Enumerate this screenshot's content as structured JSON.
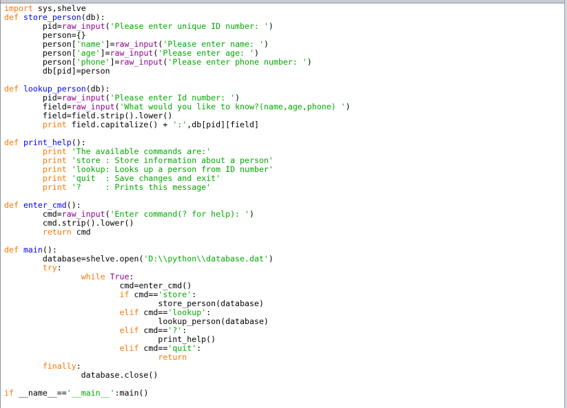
{
  "colors": {
    "keyword": "#ff7700",
    "builtin": "#900090",
    "string": "#00aa00",
    "definition": "#0000ff",
    "plain": "#000000",
    "background": "#ffffff"
  },
  "editor": {
    "lines": [
      [
        [
          "kw",
          "import"
        ],
        [
          "pl",
          " sys,shelve"
        ]
      ],
      [
        [
          "kw",
          "def"
        ],
        [
          "pl",
          " "
        ],
        [
          "df",
          "store_person"
        ],
        [
          "pl",
          "(db):"
        ]
      ],
      [
        [
          "pl",
          "        pid="
        ],
        [
          "bi",
          "raw_input"
        ],
        [
          "pl",
          "("
        ],
        [
          "str",
          "'Please enter unique ID number: '"
        ],
        [
          "pl",
          ")"
        ]
      ],
      [
        [
          "pl",
          "        person={}"
        ]
      ],
      [
        [
          "pl",
          "        person["
        ],
        [
          "str",
          "'name'"
        ],
        [
          "pl",
          "]="
        ],
        [
          "bi",
          "raw_input"
        ],
        [
          "pl",
          "("
        ],
        [
          "str",
          "'Please enter name: '"
        ],
        [
          "pl",
          ")"
        ]
      ],
      [
        [
          "pl",
          "        person["
        ],
        [
          "str",
          "'age'"
        ],
        [
          "pl",
          "]="
        ],
        [
          "bi",
          "raw_input"
        ],
        [
          "pl",
          "("
        ],
        [
          "str",
          "'Please enter age: '"
        ],
        [
          "pl",
          ")"
        ]
      ],
      [
        [
          "pl",
          "        person["
        ],
        [
          "str",
          "'phone'"
        ],
        [
          "pl",
          "]="
        ],
        [
          "bi",
          "raw_input"
        ],
        [
          "pl",
          "("
        ],
        [
          "str",
          "'Please enter phone number: '"
        ],
        [
          "pl",
          ")"
        ]
      ],
      [
        [
          "pl",
          "        db[pid]=person"
        ]
      ],
      [],
      [
        [
          "kw",
          "def"
        ],
        [
          "pl",
          " "
        ],
        [
          "df",
          "lookup_person"
        ],
        [
          "pl",
          "(db):"
        ]
      ],
      [
        [
          "pl",
          "        pid="
        ],
        [
          "bi",
          "raw_input"
        ],
        [
          "pl",
          "("
        ],
        [
          "str",
          "'Please enter Id number: '"
        ],
        [
          "pl",
          ")"
        ]
      ],
      [
        [
          "pl",
          "        field="
        ],
        [
          "bi",
          "raw_input"
        ],
        [
          "pl",
          "("
        ],
        [
          "str",
          "'What would you like to know?(name,age,phone) '"
        ],
        [
          "pl",
          ")"
        ]
      ],
      [
        [
          "pl",
          "        field=field.strip().lower()"
        ]
      ],
      [
        [
          "pl",
          "        "
        ],
        [
          "kw",
          "print"
        ],
        [
          "pl",
          " field.capitalize() + "
        ],
        [
          "str",
          "':'"
        ],
        [
          "pl",
          ",db[pid][field]"
        ]
      ],
      [],
      [
        [
          "kw",
          "def"
        ],
        [
          "pl",
          " "
        ],
        [
          "df",
          "print_help"
        ],
        [
          "pl",
          "():"
        ]
      ],
      [
        [
          "pl",
          "        "
        ],
        [
          "kw",
          "print"
        ],
        [
          "pl",
          " "
        ],
        [
          "str",
          "'The available commands are:'"
        ]
      ],
      [
        [
          "pl",
          "        "
        ],
        [
          "kw",
          "print"
        ],
        [
          "pl",
          " "
        ],
        [
          "str",
          "'store : Store information about a person'"
        ]
      ],
      [
        [
          "pl",
          "        "
        ],
        [
          "kw",
          "print"
        ],
        [
          "pl",
          " "
        ],
        [
          "str",
          "'lookup: Looks up a person from ID number'"
        ]
      ],
      [
        [
          "pl",
          "        "
        ],
        [
          "kw",
          "print"
        ],
        [
          "pl",
          " "
        ],
        [
          "str",
          "'quit  : Save changes and exit'"
        ]
      ],
      [
        [
          "pl",
          "        "
        ],
        [
          "kw",
          "print"
        ],
        [
          "pl",
          " "
        ],
        [
          "str",
          "'?     : Prints this message'"
        ]
      ],
      [],
      [
        [
          "kw",
          "def"
        ],
        [
          "pl",
          " "
        ],
        [
          "df",
          "enter_cmd"
        ],
        [
          "pl",
          "():"
        ]
      ],
      [
        [
          "pl",
          "        cmd="
        ],
        [
          "bi",
          "raw_input"
        ],
        [
          "pl",
          "("
        ],
        [
          "str",
          "'Enter command(? for help): '"
        ],
        [
          "pl",
          ")"
        ]
      ],
      [
        [
          "pl",
          "        cmd.strip().lower()"
        ]
      ],
      [
        [
          "pl",
          "        "
        ],
        [
          "kw",
          "return"
        ],
        [
          "pl",
          " cmd"
        ]
      ],
      [],
      [
        [
          "kw",
          "def"
        ],
        [
          "pl",
          " "
        ],
        [
          "df",
          "main"
        ],
        [
          "pl",
          "():"
        ]
      ],
      [
        [
          "pl",
          "        database=shelve.open("
        ],
        [
          "str",
          "'D:\\\\python\\\\database.dat'"
        ],
        [
          "pl",
          ")"
        ]
      ],
      [
        [
          "pl",
          "        "
        ],
        [
          "kw",
          "try"
        ],
        [
          "pl",
          ":"
        ]
      ],
      [
        [
          "pl",
          "                "
        ],
        [
          "kw",
          "while"
        ],
        [
          "pl",
          " "
        ],
        [
          "bi",
          "True"
        ],
        [
          "pl",
          ":"
        ]
      ],
      [
        [
          "pl",
          "                        cmd=enter_cmd()"
        ]
      ],
      [
        [
          "pl",
          "                        "
        ],
        [
          "kw",
          "if"
        ],
        [
          "pl",
          " cmd=="
        ],
        [
          "str",
          "'store'"
        ],
        [
          "pl",
          ":"
        ]
      ],
      [
        [
          "pl",
          "                                store_person(database)"
        ]
      ],
      [
        [
          "pl",
          "                        "
        ],
        [
          "kw",
          "elif"
        ],
        [
          "pl",
          " cmd=="
        ],
        [
          "str",
          "'lookup'"
        ],
        [
          "pl",
          ":"
        ]
      ],
      [
        [
          "pl",
          "                                lookup_person(database)"
        ]
      ],
      [
        [
          "pl",
          "                        "
        ],
        [
          "kw",
          "elif"
        ],
        [
          "pl",
          " cmd=="
        ],
        [
          "str",
          "'?'"
        ],
        [
          "pl",
          ":"
        ]
      ],
      [
        [
          "pl",
          "                                print_help()"
        ]
      ],
      [
        [
          "pl",
          "                        "
        ],
        [
          "kw",
          "elif"
        ],
        [
          "pl",
          " cmd=="
        ],
        [
          "str",
          "'quit'"
        ],
        [
          "pl",
          ":"
        ]
      ],
      [
        [
          "pl",
          "                                "
        ],
        [
          "kw",
          "return"
        ]
      ],
      [
        [
          "pl",
          "        "
        ],
        [
          "kw",
          "finally"
        ],
        [
          "pl",
          ":"
        ]
      ],
      [
        [
          "pl",
          "                database.close()"
        ]
      ],
      [],
      [
        [
          "kw",
          "if"
        ],
        [
          "pl",
          " __name__=="
        ],
        [
          "str",
          "'__main__'"
        ],
        [
          "pl",
          ":main()"
        ]
      ]
    ]
  }
}
